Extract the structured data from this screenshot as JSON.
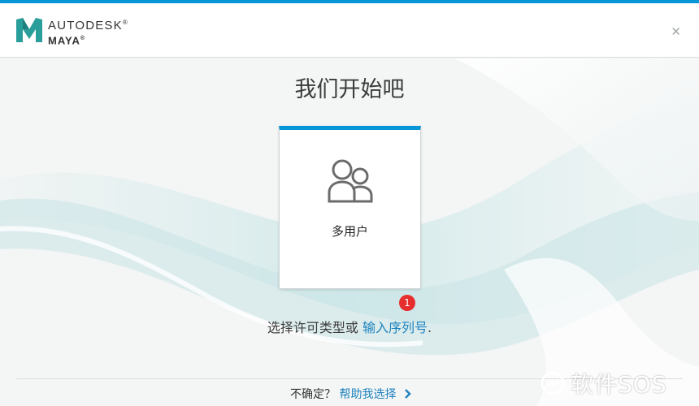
{
  "header": {
    "brand": "AUTODESK",
    "brand_mark": "®",
    "product": "MAYA",
    "product_mark": "®",
    "close_label": "✕"
  },
  "main": {
    "title": "我们开始吧",
    "cards": [
      {
        "label": "多用户",
        "icon": "multi-user-icon"
      }
    ],
    "badge_count": "1",
    "license_prompt": "选择许可类型或",
    "serial_link": "输入序列号",
    "license_suffix": "."
  },
  "footer": {
    "help_prompt": "不确定？",
    "help_link": "帮助我选择"
  },
  "watermark": {
    "text": "软件SOS"
  },
  "colors": {
    "accent": "#0696d7",
    "link": "#1d83be",
    "badge": "#e62e2e",
    "logo": "#2a9e9b"
  }
}
